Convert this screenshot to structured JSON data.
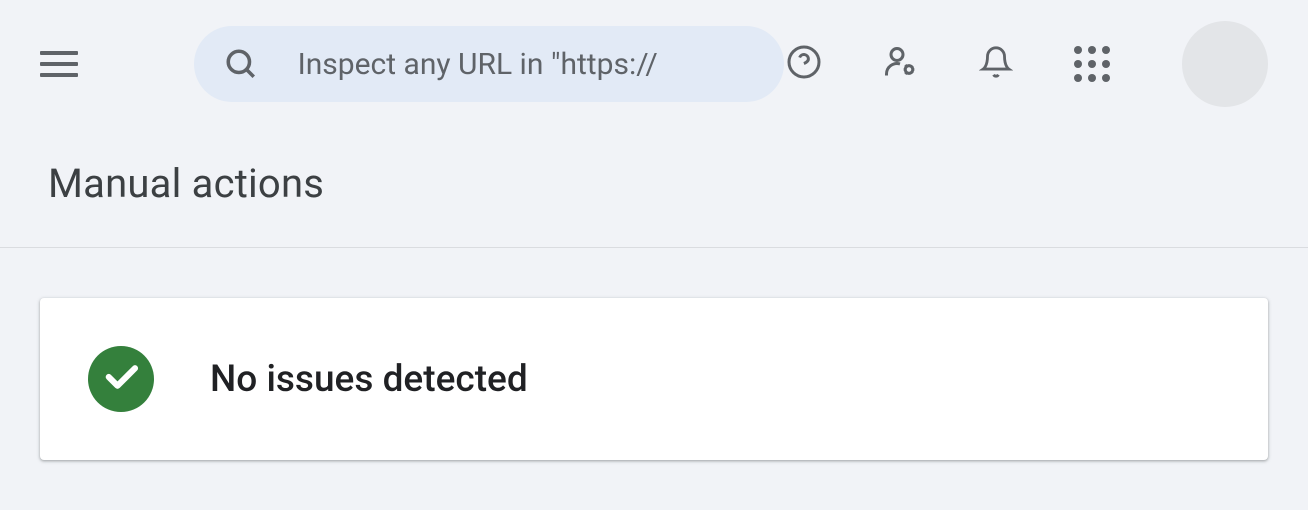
{
  "header": {
    "search_placeholder": "Inspect any URL in \"https://"
  },
  "page": {
    "title": "Manual actions"
  },
  "status": {
    "message": "No issues detected"
  }
}
